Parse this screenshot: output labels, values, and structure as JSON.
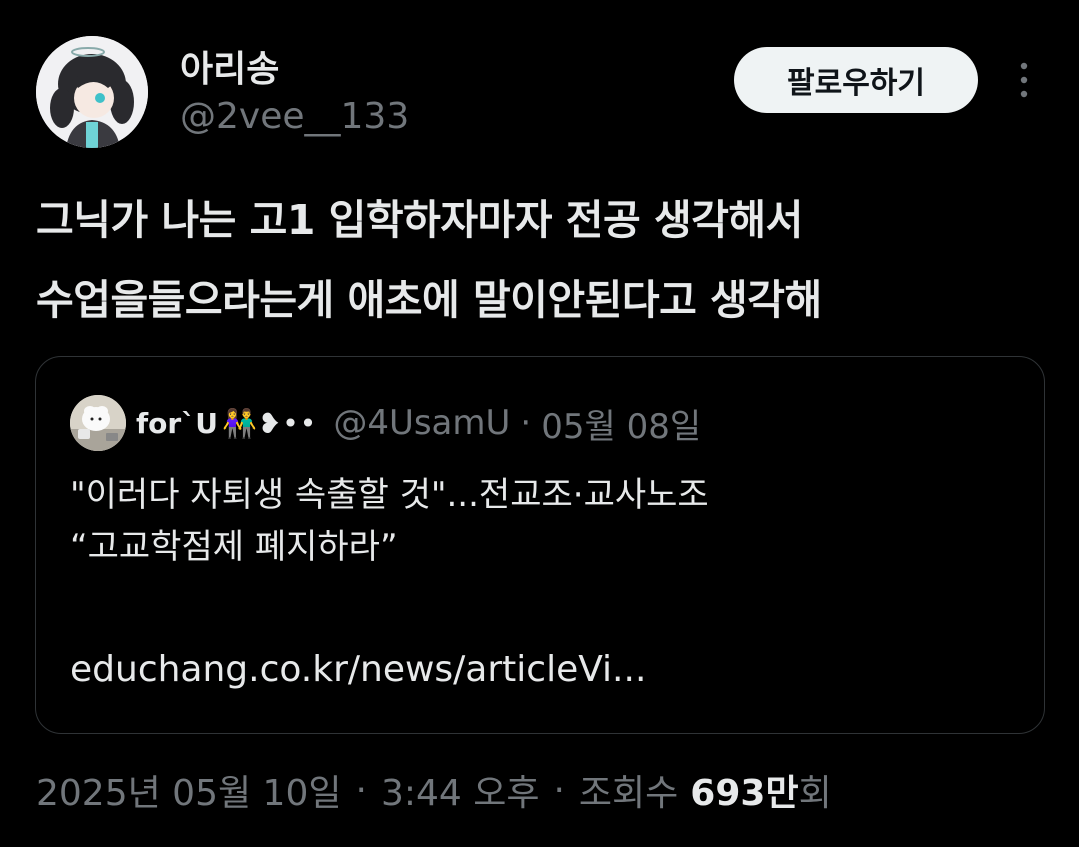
{
  "author": {
    "display_name": "아리송",
    "handle": "@2vee__133",
    "avatar_icon": "anime-character-avatar"
  },
  "follow_button_label": "팔로우하기",
  "more_icon": "more-vertical-icon",
  "tweet": {
    "lines": [
      "그닉가 나는 고1 입학하자마자 전공 생각해서",
      "수업을들으라는게 애초에 말이안된다고 생각해"
    ]
  },
  "quote": {
    "name": "for`U",
    "name_emoji": "👫❥••",
    "handle": "@4UsamU",
    "separator": "·",
    "date": "05월 08일",
    "body_lines": [
      "\"이러다 자퇴생 속출할 것\"...전교조·교사노조",
      "“고교학점제 폐지하라”"
    ],
    "link": "educhang.co.kr/news/articleVi..."
  },
  "meta": {
    "date": "2025년 05월 10일",
    "sep1": "·",
    "time": "3:44 오후",
    "sep2": "·",
    "views_label": "조회수",
    "views_count": "693만",
    "views_suffix": "회"
  },
  "colors": {
    "background": "#000000",
    "text_primary": "#e7e9ea",
    "text_secondary": "#71767b",
    "border": "#2f3336",
    "button_bg": "#eff3f4"
  }
}
